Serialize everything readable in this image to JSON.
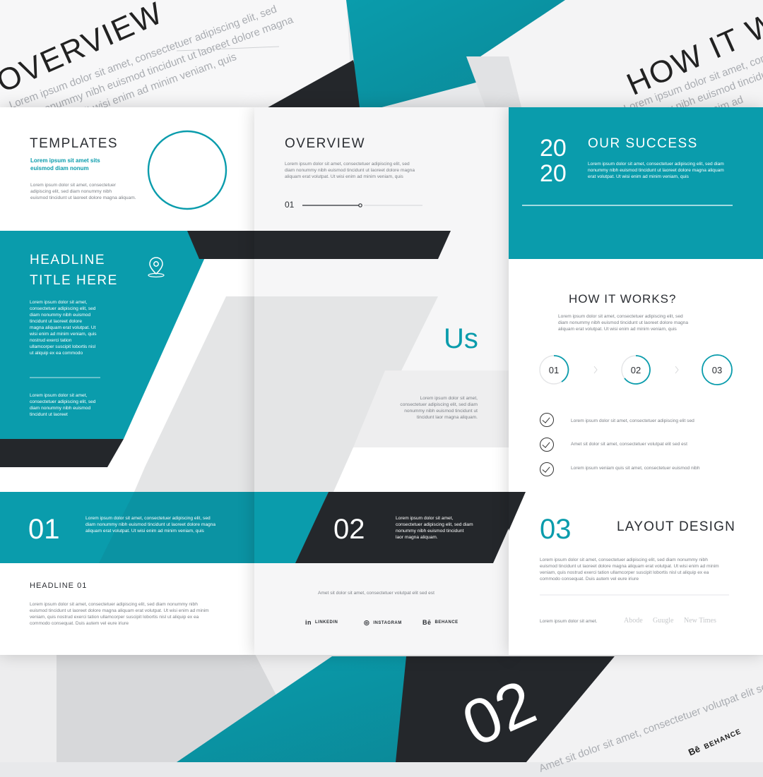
{
  "background": {
    "top_left_title": "OVERVIEW",
    "top_left_text": [
      "Lorem ipsum dolor sit amet, consectetuer adipiscing elit, sed",
      "diam nonummy nibh euismod tincidunt ut laoreet dolore magna",
      "erat volutpat. Ut wisi enim ad minim veniam, quis"
    ],
    "top_right_title": "HOW IT W",
    "top_right_text": [
      "Lorem ipsum dolor sit amet, consectetuer",
      "nonummy nibh euismod tincidunt",
      "volutpat. Ut wisi enim ad"
    ],
    "bottom_number": "02",
    "bottom_right_text": "Amet sit dolor sit amet, consectetuer volutpat elit sed est",
    "bottom_right_social": "BEHANCE",
    "bottom_right_social_icon": "Bē"
  },
  "panel_left": {
    "templates_title": "TEMPLATES",
    "templates_subtitle": [
      "Lorem ipsum sit amet sits",
      "euismod diam nonum"
    ],
    "templates_body": [
      "Lorem ipsum dolor sit amet, consectetuer",
      "adipiscing elit, sed diam nonummy nibh",
      "euismod tincidunt ut laoreet dolore magna aliquam."
    ],
    "headline_title": [
      "HEADLINE",
      "TITLE HERE"
    ],
    "headline_body": [
      "Lorem ipsum dolor sit amet,",
      "consectetuer adipiscing elit, sed",
      "diam nonummy nibh euismod",
      "tincidunt ut laoreet dolore",
      "magna aliquam erat volutpat. Ut",
      "wisi enim ad minim veniam, quis",
      "nostrud exerci tation",
      "ullamcorper suscipit lobortis nisl",
      "ut aliquip ex ea commodo"
    ],
    "headline_body2": [
      "Lorem ipsum dolor sit amet,",
      "consectetuer adipiscing elit, sed",
      "diam nonummy nibh euismod",
      "tincidunt ut laoreet"
    ],
    "band_number": "01",
    "band_text": [
      "Lorem ipsum dolor sit amet, consectetuer adipiscing elit, sed",
      "diam nonummy nibh euismod tincidunt ut laoreet dolore magna",
      "aliquam erat volutpat. Ut wisi enim ad minim veniam, quis"
    ],
    "headline01_title": "HEADLINE 01",
    "headline01_body": [
      "Lorem ipsum dolor sit amet, consectetuer adipiscing elit, sed diam nonummy nibh",
      "euismod tincidunt ut laoreet dolore magna aliquam erat volutpat. Ut wisi enim ad minim",
      "veniam, quis nostrud exerci tation ullamcorper suscipit lobortis nisl ut aliquip ex ea",
      "commodo consequat. Duis autem vel eure iriure"
    ]
  },
  "panel_middle": {
    "overview_title": "OVERVIEW",
    "overview_body": [
      "Lorem ipsum dolor sit amet, consectetuer adipiscing elit, sed",
      "diam nonummy nibh euismod tincidunt ut laoreet dolore magna",
      "aliquam erat volutpat. Ut wisi enim ad minim veniam, quis"
    ],
    "slider_label": "01",
    "us_label": "Us",
    "us_body": [
      "Lorem ipsum dolor sit amet,",
      "consectetuer adipiscing elit, sed diam",
      "nonummy nibh euismod tincidunt ut",
      "tincidunt laor magna aliquam."
    ],
    "band_number": "02",
    "band_text": [
      "Lorem ipsum dolor sit amet,",
      "consectetuer adipiscing elit, sed diam",
      "nonummy nibh euismod tincidunt",
      "laor magna aliquam."
    ],
    "footer_text": "Amet sit dolor sit amet, consectetuer volutpat elit sed est",
    "social": [
      {
        "icon": "in",
        "label": "LINKEDIN"
      },
      {
        "icon": "◎",
        "label": "INSTAGRAM"
      },
      {
        "icon": "Bē",
        "label": "BEHANCE"
      }
    ]
  },
  "panel_right": {
    "year_top": "20",
    "year_bottom": "20",
    "success_title": "OUR SUCCESS",
    "success_body": [
      "Lorem ipsum dolor sit amet, consectetuer adipiscing elit, sed diam",
      "nonummy nibh euismod tincidunt ut laoreet dolore magna aliquam",
      "erat volutpat. Ut wisi enim ad minim veniam, quis"
    ],
    "how_title": "HOW IT WORKS?",
    "how_body": [
      "Lorem ipsum dolor sit amet, consectetuer adipiscing elit, sed",
      "diam nonummy nibh euismod tincidunt ut laoreet dolore magna",
      "aliquam erat volutpat. Ut wisi enim ad minim veniam, quis"
    ],
    "steps": [
      "01",
      "02",
      "03"
    ],
    "checks": [
      "Lorem ipsum dolor sit amet, consectetuer adipiscing elit sed",
      "Amet sit dolor sit amet, consectetuer volutpat elit sed est",
      "Lorem ipsum veniam quis sit amet, consectetuer euismod nibh"
    ],
    "layout_number": "03",
    "layout_title": "LAYOUT DESIGN",
    "layout_body": [
      "Lorem ipsum dolor sit amet, consectetuer adipiscing elit, sed diam nonummy nibh",
      "euismod tincidunt ut laoreet dolore magna aliquam erat volutpat. Ut wisi enim ad minim",
      "veniam, quis nostrud exerci tation ullamcorper suscipit lobortis nisl ut aliquip ex ea",
      "commodo consequat. Duis autem vel eure iriure"
    ],
    "footer_text": "Lorem ipsum dolor sit amet.",
    "brands": [
      "Abode",
      "Guugle",
      "New Times"
    ]
  },
  "colors": {
    "teal": "#0a9cac",
    "dark": "#24272b",
    "light_gray": "#eeeff0"
  }
}
